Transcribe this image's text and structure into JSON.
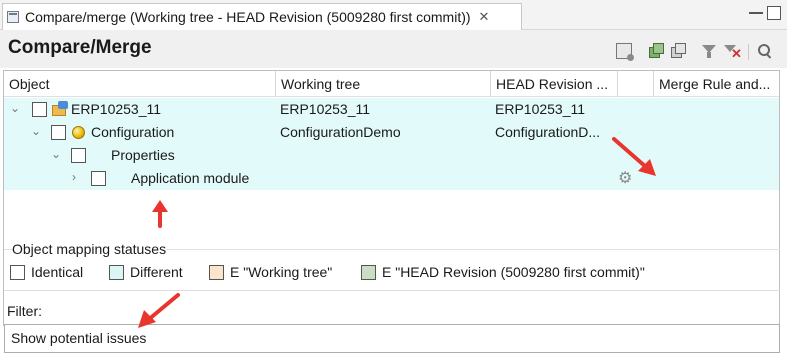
{
  "tab": {
    "title": "Compare/merge (Working tree - HEAD Revision (5009280 first commit))",
    "close_glyph": "✕"
  },
  "header": {
    "title": "Compare/Merge",
    "toolbar_icons": [
      "save-merge-icon",
      "copy-all-icon",
      "copy-icon",
      "filter-icon",
      "clear-filter-icon",
      "search-icon"
    ]
  },
  "columns": [
    "Object",
    "Working tree",
    "HEAD Revision ...",
    "",
    "Merge Rule and..."
  ],
  "rows": [
    {
      "object": "ERP10253_11",
      "working": "ERP10253_11",
      "head": "ERP10253_11",
      "chevron": "⌄",
      "icon": "project-icon"
    },
    {
      "object": "Configuration",
      "working": "ConfigurationDemo",
      "head": "ConfigurationD...",
      "chevron": "⌄",
      "icon": "configuration-icon"
    },
    {
      "object": "Properties",
      "working": "",
      "head": "",
      "chevron": "⌄",
      "icon": ""
    },
    {
      "object": "Application module",
      "working": "",
      "head": "",
      "chevron": "›",
      "icon": "gear-icon"
    }
  ],
  "statuses": {
    "title": "Object mapping statuses",
    "items": [
      {
        "label": "Identical",
        "color": "#ffffff"
      },
      {
        "label": "Different",
        "color": "#dcf6f6"
      },
      {
        "label": "E \"Working tree\"",
        "color": "#fbe4cc"
      },
      {
        "label": "E \"HEAD Revision (5009280 first commit)\"",
        "color": "#c8dfc4"
      }
    ]
  },
  "filter": {
    "label": "Filter:",
    "value": "Show potential issues"
  },
  "colors": {
    "row_highlight": "#e3fafa",
    "annotation_arrow": "#e8352e"
  }
}
